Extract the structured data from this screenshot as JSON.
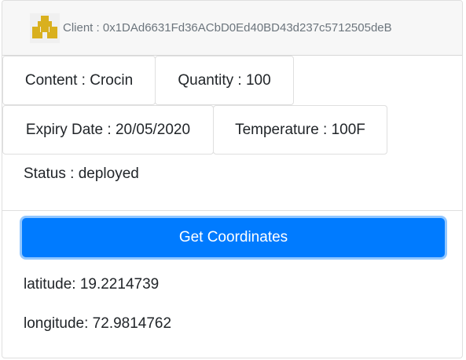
{
  "header": {
    "client_label": "Client : 0x1DAd6631Fd36ACbD0Ed40BD43d237c5712505deB",
    "avatar_icon": "identicon-avatar",
    "avatar_color": "#d9b01f"
  },
  "details": {
    "content": "Content : Crocin",
    "quantity": "Quantity : 100",
    "expiry": "Expiry Date : 20/05/2020",
    "temperature": "Temperature : 100F",
    "status": "Status : deployed"
  },
  "actions": {
    "get_coordinates_label": "Get Coordinates",
    "button_color": "#007bff"
  },
  "location": {
    "latitude": "latitude: 19.2214739",
    "longitude": "longitude: 72.9814762"
  }
}
